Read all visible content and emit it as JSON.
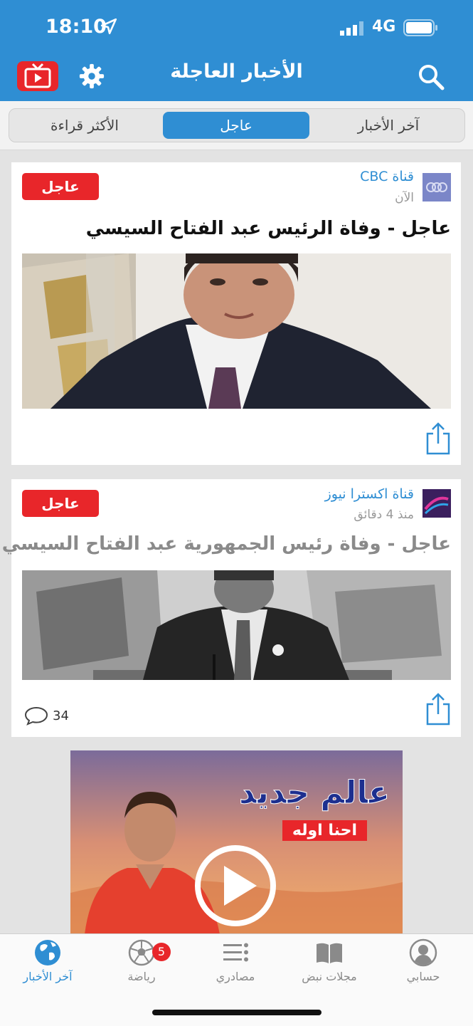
{
  "status_bar": {
    "time": "18:10",
    "network": "4G"
  },
  "header": {
    "title": "الأخبار العاجلة"
  },
  "tabs": [
    {
      "label": "آخر الأخبار",
      "active": false
    },
    {
      "label": "عاجل",
      "active": true
    },
    {
      "label": "الأكثر قراءة",
      "active": false
    }
  ],
  "articles": [
    {
      "source": "قناة CBC",
      "time": "الآن",
      "badge": "عاجل",
      "headline": "عاجل - وفاة الرئيس عبد الفتاح السيسي"
    },
    {
      "source": "قناة اكسترا نيوز",
      "time": "منذ 4 دقائق",
      "badge": "عاجل",
      "headline": "عاجل - وفاة رئيس الجمهورية عبد الفتاح السيسي",
      "comments": "34"
    }
  ],
  "ad": {
    "title": "عالم جديد",
    "subtitle": "احنا اوله"
  },
  "bottom_nav": [
    {
      "label": "حسابي",
      "icon": "account-icon"
    },
    {
      "label": "مجلات نبض",
      "icon": "magazine-icon"
    },
    {
      "label": "مصادري",
      "icon": "sources-icon"
    },
    {
      "label": "رياضة",
      "icon": "football-icon",
      "badge": "5"
    },
    {
      "label": "آخر الأخبار",
      "icon": "globe-icon",
      "active": true
    }
  ],
  "colors": {
    "primary": "#2f8ed3",
    "accent": "#e8262a"
  }
}
